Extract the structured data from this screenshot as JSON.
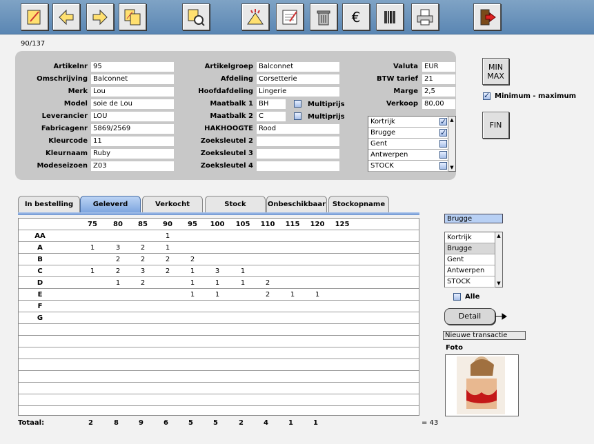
{
  "counter": "90/137",
  "toolbar": {
    "buttons": [
      "edit-icon",
      "back-arrow-icon",
      "forward-arrow-icon",
      "copy-icon",
      "search-icon",
      "new-icon",
      "notes-icon",
      "delete-icon",
      "euro-icon",
      "barcode-icon",
      "print-icon",
      "exit-icon"
    ]
  },
  "form": {
    "col1": [
      {
        "label": "Artikelnr",
        "value": "95"
      },
      {
        "label": "Omschrijving",
        "value": "Balconnet"
      },
      {
        "label": "Merk",
        "value": "Lou"
      },
      {
        "label": "Model",
        "value": "soie de Lou"
      },
      {
        "label": "Leverancier",
        "value": "LOU"
      },
      {
        "label": "Fabricagenr",
        "value": "5869/2569"
      },
      {
        "label": "Kleurcode",
        "value": "11"
      },
      {
        "label": "Kleurnaam",
        "value": "Ruby"
      },
      {
        "label": "Modeseizoen",
        "value": "Z03"
      }
    ],
    "col2": [
      {
        "label": "Artikelgroep",
        "value": "Balconnet"
      },
      {
        "label": "Afdeling",
        "value": "Corsetterie"
      },
      {
        "label": "Hoofdafdeling",
        "value": "Lingerie"
      },
      {
        "label": "Maatbalk 1",
        "value": "BH"
      },
      {
        "label": "Maatbalk 2",
        "value": "C"
      },
      {
        "label": "HAKHOOGTE",
        "value": "Rood"
      },
      {
        "label": "Zoeksleutel 2",
        "value": ""
      },
      {
        "label": "Zoeksleutel 3",
        "value": ""
      },
      {
        "label": "Zoeksleutel 4",
        "value": ""
      }
    ],
    "multiprijs_label": "Multiprijs",
    "col3": [
      {
        "label": "Valuta",
        "value": "EUR"
      },
      {
        "label": "BTW tarief",
        "value": "21"
      },
      {
        "label": "Marge",
        "value": "2,5"
      },
      {
        "label": "Verkoop",
        "value": "80,00"
      }
    ],
    "stores": [
      {
        "name": "Kortrijk",
        "checked": true
      },
      {
        "name": "Brugge",
        "checked": true
      },
      {
        "name": "Gent",
        "checked": false
      },
      {
        "name": "Antwerpen",
        "checked": false
      },
      {
        "name": "STOCK",
        "checked": false
      }
    ]
  },
  "side": {
    "minmax_line1": "MIN",
    "minmax_line2": "MAX",
    "minmax_check_label": "Minimum - maximum",
    "fin_label": "FIN"
  },
  "tabs": [
    "In bestelling",
    "Geleverd",
    "Verkocht",
    "Stock",
    "Onbeschikbaar",
    "Stockopname"
  ],
  "active_tab": "Geleverd",
  "grid": {
    "sizes": [
      "75",
      "80",
      "85",
      "90",
      "95",
      "100",
      "105",
      "110",
      "115",
      "120",
      "125"
    ],
    "rows": [
      {
        "label": "AA",
        "cells": [
          "",
          "",
          "",
          "1",
          "",
          "",
          "",
          "",
          "",
          "",
          ""
        ]
      },
      {
        "label": "A",
        "cells": [
          "1",
          "3",
          "2",
          "1",
          "",
          "",
          "",
          "",
          "",
          "",
          ""
        ]
      },
      {
        "label": "B",
        "cells": [
          "",
          "2",
          "2",
          "2",
          "2",
          "",
          "",
          "",
          "",
          "",
          ""
        ]
      },
      {
        "label": "C",
        "cells": [
          "1",
          "2",
          "3",
          "2",
          "1",
          "3",
          "1",
          "",
          "",
          "",
          ""
        ]
      },
      {
        "label": "D",
        "cells": [
          "",
          "1",
          "2",
          "",
          "1",
          "1",
          "1",
          "2",
          "",
          "",
          ""
        ]
      },
      {
        "label": "E",
        "cells": [
          "",
          "",
          "",
          "",
          "1",
          "1",
          "",
          "2",
          "1",
          "1",
          ""
        ]
      },
      {
        "label": "F",
        "cells": [
          "",
          "",
          "",
          "",
          "",
          "",
          "",
          "",
          "",
          "",
          ""
        ]
      },
      {
        "label": "G",
        "cells": [
          "",
          "",
          "",
          "",
          "",
          "",
          "",
          "",
          "",
          "",
          ""
        ]
      }
    ],
    "totals_label": "Totaal:",
    "totals": [
      "2",
      "8",
      "9",
      "6",
      "5",
      "5",
      "2",
      "4",
      "1",
      "1",
      ""
    ],
    "grand_total": "= 43"
  },
  "right": {
    "selected_store": "Brugge",
    "store_list": [
      "Kortrijk",
      "Brugge",
      "Gent",
      "Antwerpen",
      "STOCK"
    ],
    "selected_index": 1,
    "alle_label": "Alle",
    "detail_label": "Detail",
    "transaction_label": "Nieuwe transactie",
    "foto_label": "Foto"
  }
}
